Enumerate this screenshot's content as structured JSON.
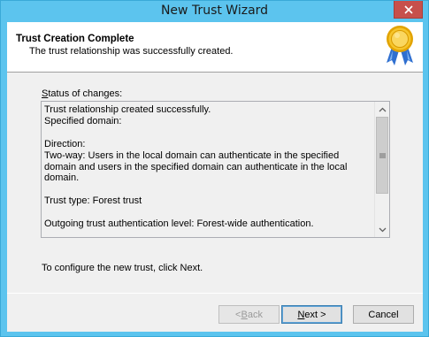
{
  "window": {
    "title": "New Trust Wizard"
  },
  "header": {
    "title": "Trust Creation Complete",
    "subtitle": "The trust relationship was successfully created.",
    "badge_icon": "award-ribbon-icon"
  },
  "status": {
    "label_prefix": "S",
    "label_rest": "tatus of changes:",
    "text": "Trust relationship created successfully.\nSpecified domain:\n\nDirection:\nTwo-way: Users in the local domain can authenticate in the specified domain and users in the specified domain can authenticate in the local domain.\n\nTrust type: Forest trust\n\nOutgoing trust authentication level: Forest-wide authentication."
  },
  "footer": {
    "instruction": "To configure the new trust, click Next."
  },
  "buttons": {
    "back_prefix": "< ",
    "back_key": "B",
    "back_rest": "ack",
    "next_key": "N",
    "next_rest": "ext >",
    "cancel": "Cancel"
  },
  "colors": {
    "titlebar": "#5cc4ee",
    "close": "#c7504b",
    "dialog_bg": "#f0f0f0"
  }
}
